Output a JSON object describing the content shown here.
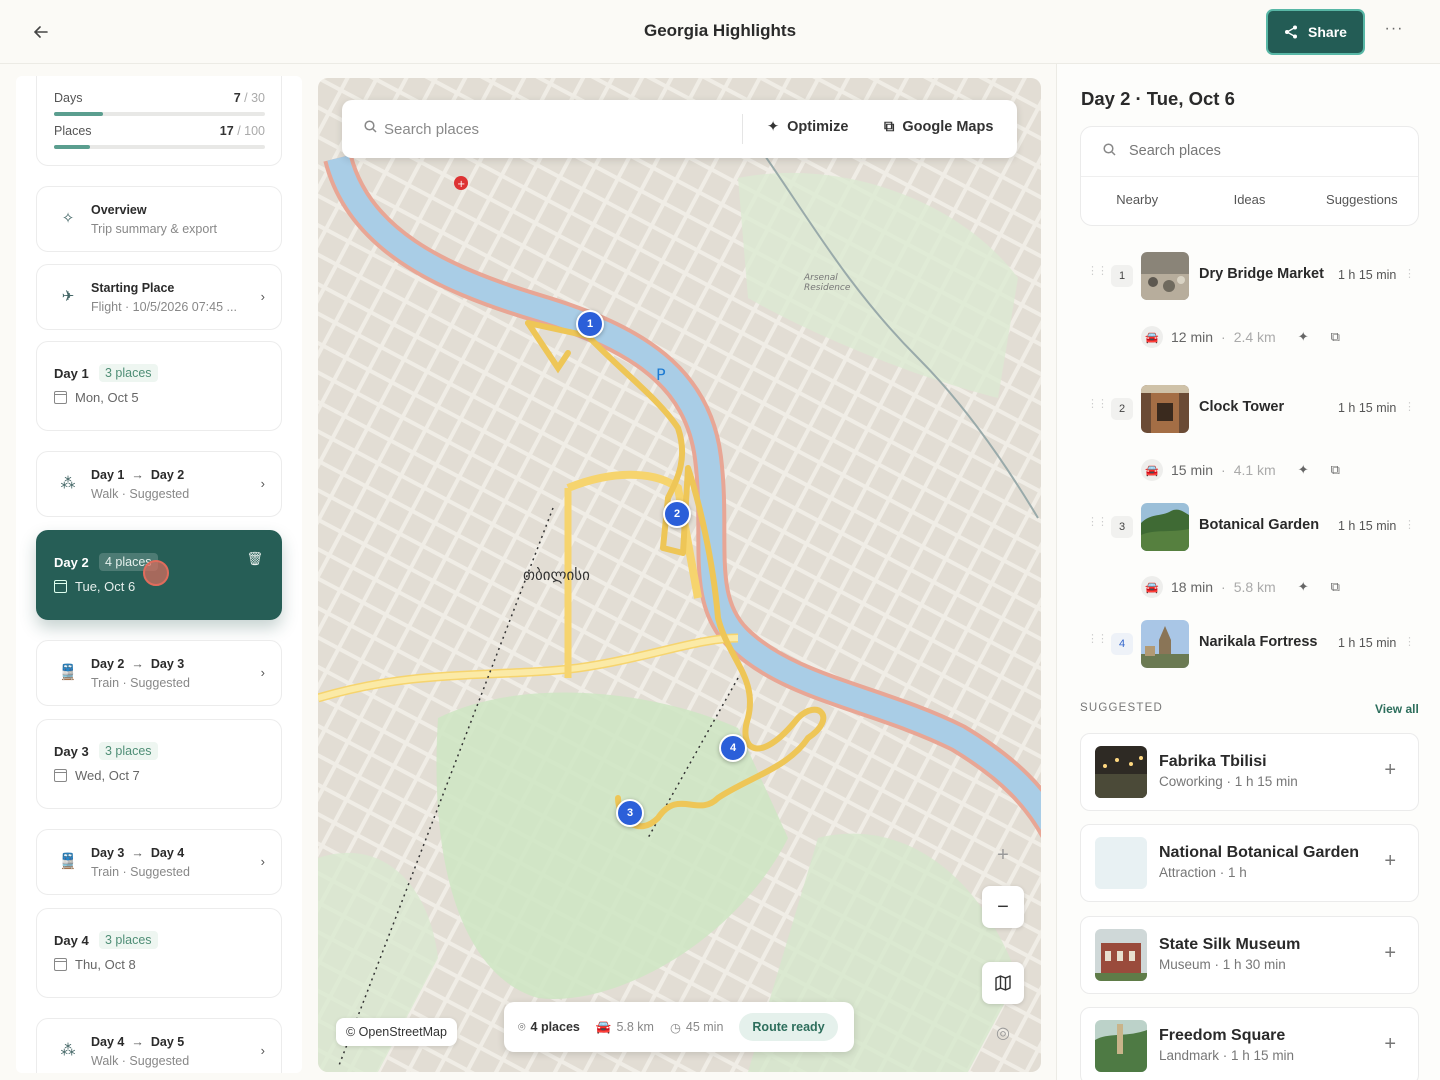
{
  "header": {
    "title": "Georgia Highlights",
    "share_label": "Share"
  },
  "sidebar": {
    "stats": [
      {
        "label": "Days",
        "value": "7",
        "total": "/ 30",
        "progress": 0.23
      },
      {
        "label": "Places",
        "value": "17",
        "total": "/ 100",
        "progress": 0.17
      }
    ],
    "overview": {
      "title": "Overview",
      "subtitle": "Trip summary & export"
    },
    "starting": {
      "title": "Starting Place",
      "subtitle": "Flight · 10/5/2026 07:45 ..."
    },
    "day1": {
      "title": "Day 1",
      "pill": "3 places",
      "date": "Mon, Oct 5"
    },
    "tr12": {
      "from": "Day 1",
      "to": "Day 2",
      "subtitle": "Walk · Suggested"
    },
    "day2": {
      "title": "Day 2",
      "pill": "4 places",
      "date": "Tue, Oct 6"
    },
    "tr23": {
      "from": "Day 2",
      "to": "Day 3",
      "subtitle": "Train · Suggested"
    },
    "day3": {
      "title": "Day 3",
      "pill": "3 places",
      "date": "Wed, Oct 7"
    },
    "tr34": {
      "from": "Day 3",
      "to": "Day 4",
      "subtitle": "Train · Suggested"
    },
    "day4": {
      "title": "Day 4",
      "pill": "3 places",
      "date": "Thu, Oct 8"
    },
    "tr45": {
      "from": "Day 4",
      "to": "Day 5",
      "subtitle": "Walk · Suggested"
    }
  },
  "map": {
    "search_placeholder": "Search places",
    "optimize_label": "Optimize",
    "google_maps_label": "Google Maps",
    "attribution": "© OpenStreetMap",
    "city_label": "თბილისი",
    "pins": [
      "1",
      "2",
      "3",
      "4"
    ],
    "summary": {
      "places": "4 places",
      "distance": "5.8 km",
      "time": "45 min",
      "status": "Route ready"
    },
    "zoom_in": "+",
    "zoom_out": "−"
  },
  "panel": {
    "title": "Day 2 · Tue, Oct 6",
    "search_placeholder": "Search places",
    "tabs": [
      "Nearby",
      "Ideas",
      "Suggestions"
    ],
    "stops": [
      {
        "num": "1",
        "name": "Dry Bridge Market",
        "duration": "1 h 15 min"
      },
      {
        "num": "2",
        "name": "Clock Tower",
        "duration": "1 h 15 min"
      },
      {
        "num": "3",
        "name": "Botanical Garden",
        "duration": "1 h 15 min"
      },
      {
        "num": "4",
        "name": "Narikala Fortress",
        "duration": "1 h 15 min"
      }
    ],
    "legs": [
      {
        "time": "12 min",
        "dist": "2.4 km"
      },
      {
        "time": "15 min",
        "dist": "4.1 km"
      },
      {
        "time": "18 min",
        "dist": "5.8 km"
      }
    ],
    "suggested_label": "SUGGESTED",
    "view_all": "View all",
    "suggestions": [
      {
        "name": "Fabrika Tbilisi",
        "meta": "Coworking · 1 h 15 min"
      },
      {
        "name": "National Botanical Garden",
        "meta": "Attraction · 1 h"
      },
      {
        "name": "State Silk Museum",
        "meta": "Museum · 1 h 30 min"
      },
      {
        "name": "Freedom Square",
        "meta": "Landmark · 1 h 15 min"
      }
    ]
  }
}
